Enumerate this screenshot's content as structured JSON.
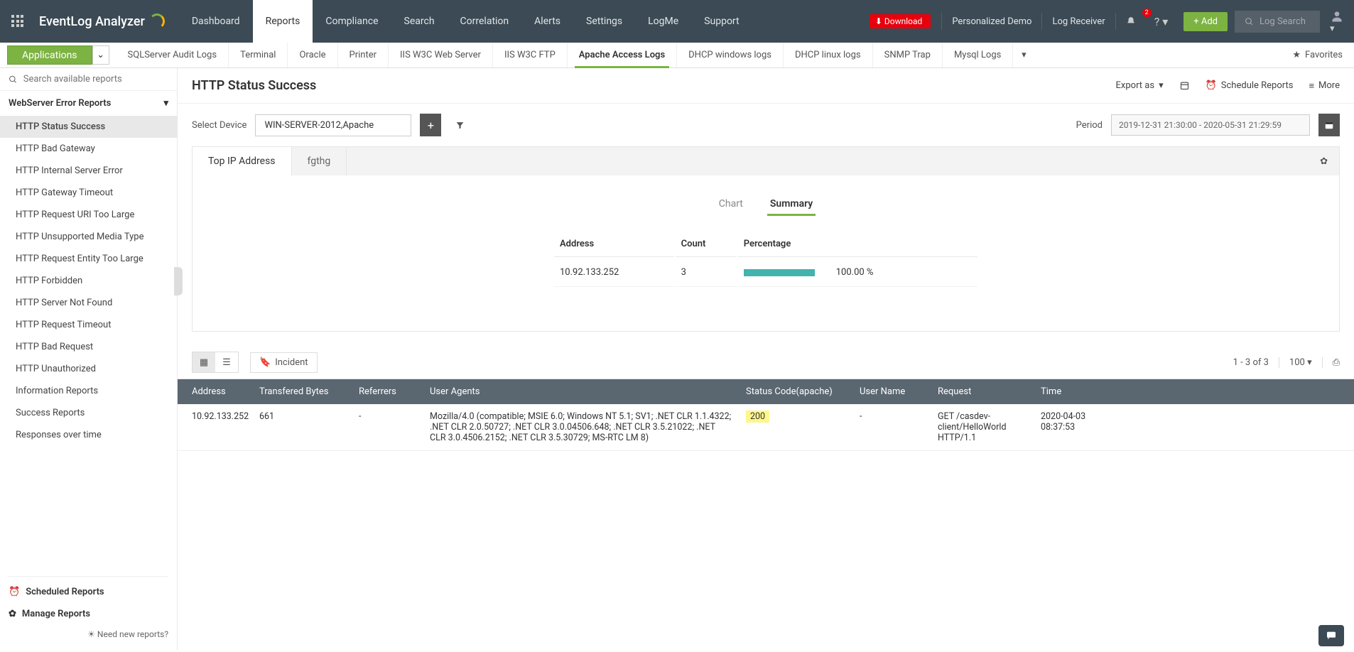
{
  "topbar": {
    "logo": "EventLog Analyzer",
    "download": "Download",
    "personalized": "Personalized Demo",
    "log_receiver": "Log Receiver",
    "notif_count": "2",
    "add": "+  Add",
    "log_search": "Log Search",
    "nav": [
      "Dashboard",
      "Reports",
      "Compliance",
      "Search",
      "Correlation",
      "Alerts",
      "Settings",
      "LogMe",
      "Support"
    ]
  },
  "subbar": {
    "applications": "Applications",
    "items": [
      "SQLServer Audit Logs",
      "Terminal",
      "Oracle",
      "Printer",
      "IIS W3C Web Server",
      "IIS W3C FTP",
      "Apache Access Logs",
      "DHCP windows logs",
      "DHCP linux logs",
      "SNMP Trap",
      "Mysql Logs"
    ],
    "active_index": 6,
    "favorites": "Favorites"
  },
  "sidebar": {
    "search_placeholder": "Search available reports",
    "group": "WebServer Error Reports",
    "items": [
      "HTTP Status Success",
      "HTTP Bad Gateway",
      "HTTP Internal Server Error",
      "HTTP Gateway Timeout",
      "HTTP Request URI Too Large",
      "HTTP Unsupported Media Type",
      "HTTP Request Entity Too Large",
      "HTTP Forbidden",
      "HTTP Server Not Found",
      "HTTP Request Timeout",
      "HTTP Bad Request",
      "HTTP Unauthorized",
      "Information Reports",
      "Success Reports",
      "Responses over time"
    ],
    "scheduled": "Scheduled Reports",
    "manage": "Manage Reports",
    "need": "Need new reports?"
  },
  "page": {
    "title": "HTTP Status Success",
    "export": "Export as",
    "schedule": "Schedule Reports",
    "more": "More",
    "select_device_label": "Select Device",
    "device_value": "WIN-SERVER-2012,Apache",
    "period_label": "Period",
    "period_value": "2019-12-31 21:30:00 - 2020-05-31 21:29:59"
  },
  "tabs": {
    "outer": [
      "Top IP Address",
      "fgthg"
    ],
    "inner": [
      "Chart",
      "Summary"
    ]
  },
  "summary": {
    "headers": [
      "Address",
      "Count",
      "Percentage"
    ],
    "row": {
      "address": "10.92.133.252",
      "count": "3",
      "pct": "100.00 %"
    }
  },
  "detail": {
    "incident": "Incident",
    "range": "1 - 3 of 3",
    "per_page": "100",
    "headers": [
      "Address",
      "Transfered Bytes",
      "Referrers",
      "User Agents",
      "Status Code(apache)",
      "User Name",
      "Request",
      "Time"
    ],
    "row": {
      "address": "10.92.133.252",
      "bytes": "661",
      "referrers": "-",
      "ua": "Mozilla/4.0 (compatible; MSIE 6.0; Windows NT 5.1; SV1; .NET CLR 1.1.4322; .NET CLR 2.0.50727; .NET CLR 3.0.04506.648; .NET CLR 3.5.21022; .NET CLR 3.0.4506.2152; .NET CLR 3.5.30729; MS-RTC LM 8)",
      "status": "200",
      "user": "-",
      "request": "GET /casdev-client/HelloWorld HTTP/1.1",
      "time": "2020-04-03 08:37:53"
    }
  }
}
